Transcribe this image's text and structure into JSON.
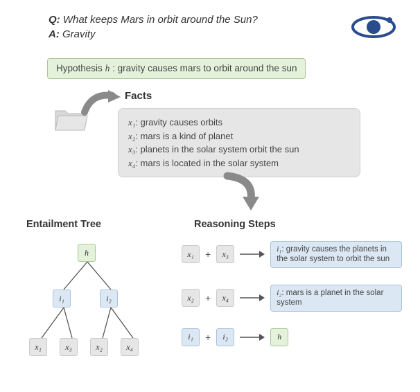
{
  "qa": {
    "q_label": "Q:",
    "question": "What keeps Mars in orbit around the Sun?",
    "a_label": "A:",
    "answer": "Gravity"
  },
  "hypothesis": {
    "prefix": "Hypothesis",
    "var": "h",
    "text": ": gravity causes mars to orbit around the sun"
  },
  "facts": {
    "heading": "Facts",
    "items": [
      {
        "var": "x₁",
        "text": ": gravity causes orbits"
      },
      {
        "var": "x₂",
        "text": ": mars is a kind of planet"
      },
      {
        "var": "x₃",
        "text": ": planets in the solar system orbit the sun"
      },
      {
        "var": "x₄",
        "text": ": mars is located in the solar system"
      }
    ]
  },
  "sections": {
    "entailment_tree": "Entailment Tree",
    "reasoning_steps": "Reasoning Steps"
  },
  "tree": {
    "root": "h",
    "mids": [
      "i₁",
      "i₂"
    ],
    "leaves": [
      "x₁",
      "x₃",
      "x₂",
      "x₄"
    ]
  },
  "steps": [
    {
      "a": "x₁",
      "a_cls": "gray",
      "b": "x₃",
      "b_cls": "gray",
      "r_var": "i₁",
      "r_text": ": gravity causes the planets in the solar system to orbit the sun",
      "r_cls": "blue"
    },
    {
      "a": "x₂",
      "a_cls": "gray",
      "b": "x₄",
      "b_cls": "gray",
      "r_var": "i₂",
      "r_text": ": mars is a planet in the solar system",
      "r_cls": "blue"
    },
    {
      "a": "i₁",
      "a_cls": "blue",
      "b": "i₂",
      "b_cls": "blue",
      "r_var": "h",
      "r_text": "",
      "r_cls": "green"
    }
  ],
  "colors": {
    "green_bg": "#e4f2dc",
    "blue_bg": "#dbe8f4",
    "gray_bg": "#e6e6e6",
    "planet": "#2a4b8d"
  }
}
